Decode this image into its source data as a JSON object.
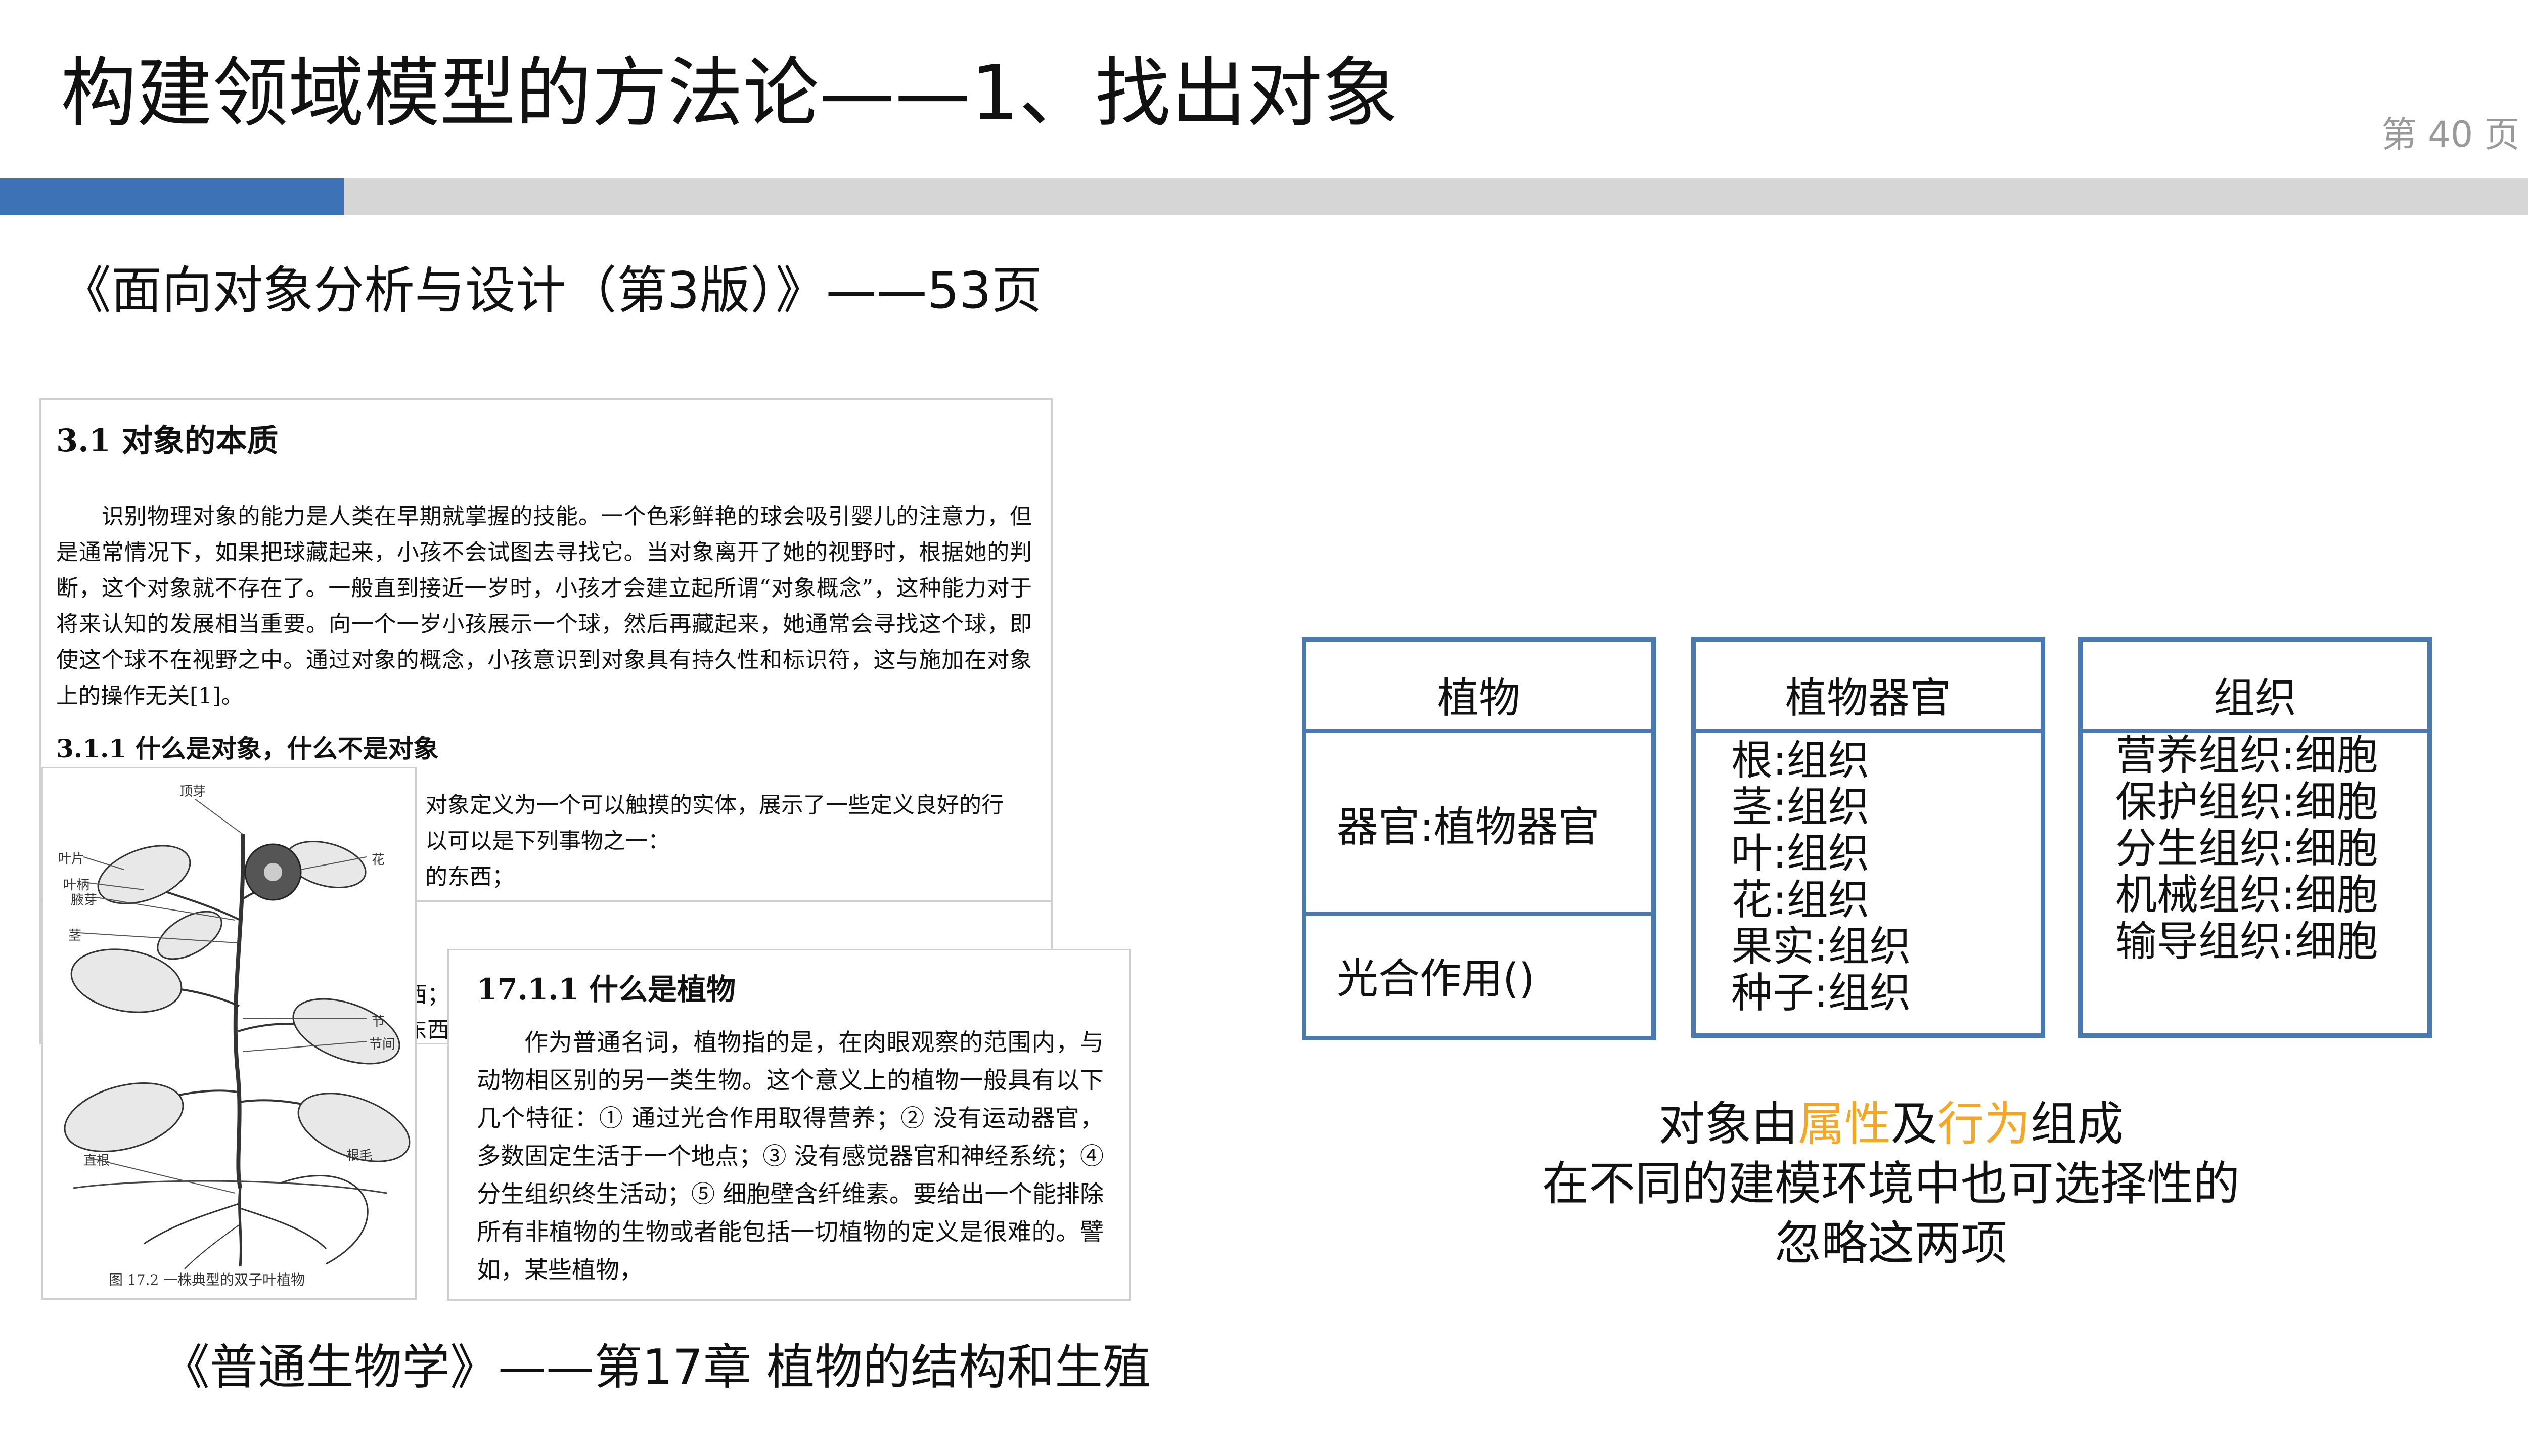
{
  "slide": {
    "title": "构建领域模型的方法论——1、找出对象",
    "page_number": "第 40 页",
    "colors": {
      "accent_bar": "#3d72b6",
      "bar_track": "#d6d6d6",
      "uml_border": "#4a78b0",
      "highlight": "#f5a623"
    }
  },
  "sources": {
    "ooad": "《面向对象分析与设计（第3版）》——53页",
    "biology": "《普通生物学》——第17章 植物的结构和生殖"
  },
  "book_excerpt": {
    "heading": "3.1   对象的本质",
    "paragraph": "识别物理对象的能力是人类在早期就掌握的技能。一个色彩鲜艳的球会吸引婴儿的注意力，但是通常情况下，如果把球藏起来，小孩不会试图去寻找它。当对象离开了她的视野时，根据她的判断，这个对象就不存在了。一般直到接近一岁时，小孩才会建立起所谓“对象概念”，这种能力对于将来认知的发展相当重要。向一个一岁小孩展示一个球，然后再藏起来，她通常会寻找这个球，即使这个球不在视野之中。通过对象的概念，小孩意识到对象具有持久性和标识符，这与施加在对象上的操作无关[1]。",
    "subheading": "3.1.1   什么是对象，什么不是对象",
    "partial_lines": [
      "对象定义为一个可以触摸的实体，展示了一些定义良好的行",
      "以可以是下列事物之一：",
      "的东西；"
    ],
    "lower_fragments": [
      "西；",
      "东西"
    ]
  },
  "plant_figure": {
    "labels": {
      "apical_bud": "顶芽",
      "leaf_blade": "叶片",
      "petiole": "叶柄",
      "axillary_bud": "腋芽",
      "flower": "花",
      "stem": "茎",
      "node": "节",
      "internode": "节间",
      "taproot": "直根",
      "root_hair": "根毛"
    },
    "caption": "图 17.2    一株典型的双子叶植物"
  },
  "biology_excerpt": {
    "heading": "17.1.1    什么是植物",
    "paragraph": "作为普通名词，植物指的是，在肉眼观察的范围内，与动物相区别的另一类生物。这个意义上的植物一般具有以下几个特征：① 通过光合作用取得营养；② 没有运动器官，多数固定生活于一个地点；③ 没有感觉器官和神经系统；④ 分生组织终生活动；⑤ 细胞壁含纤维素。要给出一个能排除所有非植物的生物或者能包括一切植物的定义是很难的。譬如，某些植物，"
  },
  "uml": {
    "plant": {
      "name": "植物",
      "attribute": "器官:植物器官",
      "operation": "光合作用()"
    },
    "organ": {
      "name": "植物器官",
      "attributes": [
        "根:组织",
        "茎:组织",
        "叶:组织",
        "花:组织",
        "果实:组织",
        "种子:组织"
      ]
    },
    "tissue": {
      "name": "组织",
      "attributes": [
        "营养组织:细胞",
        "保护组织:细胞",
        "分生组织:细胞",
        "机械组织:细胞",
        "输导组织:细胞"
      ]
    }
  },
  "note": {
    "line1_pre": "对象由",
    "line1_attr": "属性",
    "line1_mid": "及",
    "line1_behavior": "行为",
    "line1_post": "组成",
    "line2": "在不同的建模环境中也可选择性的",
    "line3": "忽略这两项"
  }
}
